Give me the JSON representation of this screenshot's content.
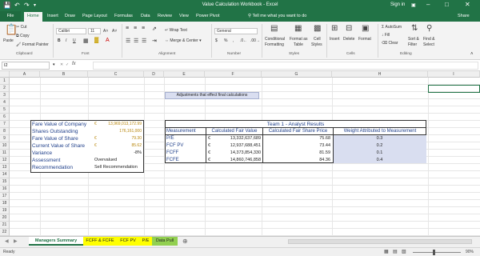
{
  "window": {
    "title": "Value Calculation Workbook  -  Excel",
    "signin": "Sign in"
  },
  "quick_access": [
    "save-icon",
    "undo-icon",
    "redo-icon",
    "customize-icon"
  ],
  "window_controls": [
    "ribbon-display-icon",
    "minimize-icon",
    "restore-icon",
    "close-icon"
  ],
  "tabs": [
    "File",
    "Home",
    "Insert",
    "Draw",
    "Page Layout",
    "Formulas",
    "Data",
    "Review",
    "View",
    "Power Pivot"
  ],
  "tell_me": "Tell me what you want to do",
  "share": "Share",
  "ribbon": {
    "clipboard": {
      "paste": "Paste",
      "cut": "Cut",
      "copy": "Copy",
      "format_painter": "Format Painter",
      "label": "Clipboard"
    },
    "font": {
      "name": "Calibri",
      "size": "11",
      "bold": "B",
      "italic": "I",
      "underline": "U",
      "label": "Font"
    },
    "alignment": {
      "wrap": "Wrap Text",
      "merge": "Merge & Center",
      "label": "Alignment"
    },
    "number": {
      "format": "General",
      "currency": "$",
      "percent": "%",
      "comma": ",",
      "label": "Number"
    },
    "styles": {
      "conditional": "Conditional",
      "conditional2": "Formatting",
      "format_table": "Format as",
      "format_table2": "Table",
      "cell_styles": "Cell",
      "cell_styles2": "Styles",
      "label": "Styles"
    },
    "cells": {
      "insert": "Insert",
      "delete": "Delete",
      "format": "Format",
      "label": "Cells"
    },
    "editing": {
      "autosum": "AutoSum",
      "fill": "Fill",
      "clear": "Clear",
      "sort": "Sort &",
      "sort2": "Filter",
      "find": "Find &",
      "find2": "Select",
      "label": "Editing"
    }
  },
  "formula_bar": {
    "name_box": "I2",
    "fx": "fx",
    "content": ""
  },
  "columns": [
    "A",
    "B",
    "C",
    "D",
    "E",
    "F",
    "G",
    "H",
    "I"
  ],
  "rows": [
    "1",
    "2",
    "3",
    "4",
    "5",
    "6",
    "7",
    "8",
    "9",
    "10",
    "11",
    "12",
    "13",
    "14",
    "15",
    "16",
    "17",
    "18",
    "19",
    "20",
    "21",
    "22"
  ],
  "banner": "Adjustments that effect final calculations",
  "summary": {
    "labels": [
      "Fare Value of Company",
      "Shares Outstanding",
      "Fare Value of Share",
      "Current Value of Share",
      "Variance",
      "Assessment",
      "Recommendation"
    ],
    "values": [
      "13,969,013,172.99",
      "176,161,000",
      "79.30",
      "85.62",
      "-8%",
      "Overvalued",
      "Sell Recommendation"
    ],
    "currency_symbol": "€"
  },
  "analyst_table": {
    "title": "Team 1 - Analyst Results",
    "headers": [
      "Measurement",
      "Calculated Fair Value",
      "Calculated Fair Share Price",
      "Weight Attributed to Measurement"
    ],
    "rows": [
      {
        "measurement": "P/E",
        "currency": "€",
        "fair_value": "13,332,637,689",
        "share_price": "75.68",
        "weight": "0.3"
      },
      {
        "measurement": "FCF PV",
        "currency": "€",
        "fair_value": "12,937,688,451",
        "share_price": "73.44",
        "weight": "0.2"
      },
      {
        "measurement": "FCFF",
        "currency": "€",
        "fair_value": "14,373,854,330",
        "share_price": "81.59",
        "weight": "0.1"
      },
      {
        "measurement": "FCFE",
        "currency": "€",
        "fair_value": "14,860,746,858",
        "share_price": "84.36",
        "weight": "0.4"
      }
    ]
  },
  "sheet_tabs": [
    {
      "label": "Managers Summary",
      "active": true
    },
    {
      "label": "FCFF & FCFE",
      "active": false
    },
    {
      "label": "FCF PV",
      "active": false
    },
    {
      "label": "P/E",
      "active": false
    },
    {
      "label": "Data Pull",
      "active": false
    }
  ],
  "status": {
    "ready": "Ready",
    "zoom": "90%"
  },
  "colors": {
    "excel_green": "#217346",
    "label_blue": "#1f3f8a",
    "value_gold": "#b8860b",
    "weight_fill": "#d9def0",
    "banner_fill": "#d9def0",
    "tab_yellow": "#ffff00",
    "tab_green": "#92d050"
  }
}
